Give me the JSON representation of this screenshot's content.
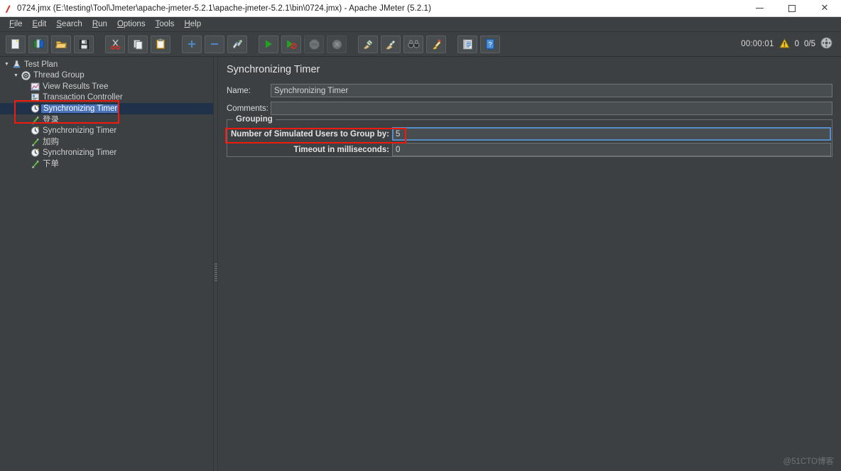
{
  "window": {
    "title": "0724.jmx (E:\\testing\\Tool\\Jmeter\\apache-jmeter-5.2.1\\apache-jmeter-5.2.1\\bin\\0724.jmx) - Apache JMeter (5.2.1)",
    "app_icon": "jmeter-feather-icon",
    "minimize": "–",
    "maximize": "□",
    "close": "✕"
  },
  "menubar": {
    "items": [
      {
        "label": "File",
        "mnemonic": "F",
        "rest": "ile"
      },
      {
        "label": "Edit",
        "mnemonic": "E",
        "rest": "dit"
      },
      {
        "label": "Search",
        "mnemonic": "S",
        "rest": "earch"
      },
      {
        "label": "Run",
        "mnemonic": "R",
        "rest": "un"
      },
      {
        "label": "Options",
        "mnemonic": "O",
        "rest": "ptions"
      },
      {
        "label": "Tools",
        "mnemonic": "T",
        "rest": "ools"
      },
      {
        "label": "Help",
        "mnemonic": "H",
        "rest": "elp"
      }
    ]
  },
  "toolbar": {
    "buttons": [
      {
        "name": "new-test-plan-button",
        "icon": "new-document-icon",
        "enabled": true
      },
      {
        "name": "templates-button",
        "icon": "templates-icon",
        "enabled": true
      },
      {
        "name": "open-button",
        "icon": "open-folder-icon",
        "enabled": true
      },
      {
        "name": "save-button",
        "icon": "save-floppy-icon",
        "enabled": true
      },
      {
        "name": "cut-button",
        "icon": "scissors-icon",
        "enabled": true
      },
      {
        "name": "copy-button",
        "icon": "copy-pages-icon",
        "enabled": true
      },
      {
        "name": "paste-button",
        "icon": "clipboard-icon",
        "enabled": true
      },
      {
        "name": "expand-all-button",
        "icon": "plus-icon",
        "enabled": true
      },
      {
        "name": "collapse-all-button",
        "icon": "minus-icon",
        "enabled": true
      },
      {
        "name": "toggle-button",
        "icon": "toggle-pencil-icon",
        "enabled": true
      },
      {
        "name": "start-button",
        "icon": "play-green-icon",
        "enabled": true
      },
      {
        "name": "start-no-pauses-button",
        "icon": "play-no-pause-icon",
        "enabled": true
      },
      {
        "name": "stop-button",
        "icon": "stop-octagon-icon",
        "enabled": false
      },
      {
        "name": "shutdown-button",
        "icon": "shutdown-x-icon",
        "enabled": false
      },
      {
        "name": "clear-button",
        "icon": "clear-broom-icon",
        "enabled": true
      },
      {
        "name": "clear-all-button",
        "icon": "clear-all-broom-icon",
        "enabled": true
      },
      {
        "name": "search-button",
        "icon": "binoculars-icon",
        "enabled": true
      },
      {
        "name": "reset-search-button",
        "icon": "reset-search-icon",
        "enabled": true
      },
      {
        "name": "function-helper-button",
        "icon": "function-list-icon",
        "enabled": true
      },
      {
        "name": "help-button",
        "icon": "help-book-icon",
        "enabled": true
      }
    ],
    "status": {
      "elapsed_time": "00:00:01",
      "warning_icon": "warning-triangle-icon",
      "warning_count": "0",
      "threads": "0/5",
      "indicator_icon": "thread-indicator-icon"
    }
  },
  "tree": {
    "nodes": [
      {
        "label": "Test Plan",
        "icon": "test-plan-icon",
        "indent": 1,
        "twist": "▼",
        "selected": false
      },
      {
        "label": "Thread Group",
        "icon": "thread-group-icon",
        "indent": 2,
        "twist": "▼",
        "selected": false
      },
      {
        "label": "View Results Tree",
        "icon": "view-results-tree-icon",
        "indent": 3,
        "twist": "",
        "selected": false
      },
      {
        "label": "Transaction Controller",
        "icon": "transaction-controller-icon",
        "indent": 3,
        "twist": "",
        "selected": false
      },
      {
        "label": "Synchronizing Timer",
        "icon": "timer-clock-icon",
        "indent": 3,
        "twist": "",
        "selected": true
      },
      {
        "label": "登录",
        "icon": "sampler-pen-icon",
        "indent": 3,
        "twist": "",
        "selected": false
      },
      {
        "label": "Synchronizing Timer",
        "icon": "timer-clock-icon",
        "indent": 3,
        "twist": "",
        "selected": false
      },
      {
        "label": "加购",
        "icon": "sampler-pen-icon",
        "indent": 3,
        "twist": "",
        "selected": false
      },
      {
        "label": "Synchronizing Timer",
        "icon": "timer-clock-icon",
        "indent": 3,
        "twist": "",
        "selected": false
      },
      {
        "label": "下单",
        "icon": "sampler-pen-icon",
        "indent": 3,
        "twist": "",
        "selected": false
      }
    ]
  },
  "main": {
    "panel_title": "Synchronizing Timer",
    "name_label": "Name:",
    "name_value": "Synchronizing Timer",
    "comments_label": "Comments:",
    "comments_value": "",
    "grouping": {
      "legend": "Grouping",
      "users_label": "Number of Simulated Users to Group by:",
      "users_value": "5",
      "timeout_label": "Timeout in milliseconds:",
      "timeout_value": "0"
    }
  },
  "annotations": {
    "tree_highlight": "red-rectangle-tree",
    "field_highlight": "red-rectangle-users-field"
  },
  "watermark": "@51CTO博客",
  "colors": {
    "panel_bg": "#3c4043",
    "field_bg": "#484d50",
    "selection_band": "#1f3249",
    "selection_text_bg": "#4a72b8",
    "focus_border": "#5b93cf",
    "annotation_red": "#f01b0e",
    "titlebar_bg": "#ffffff"
  }
}
